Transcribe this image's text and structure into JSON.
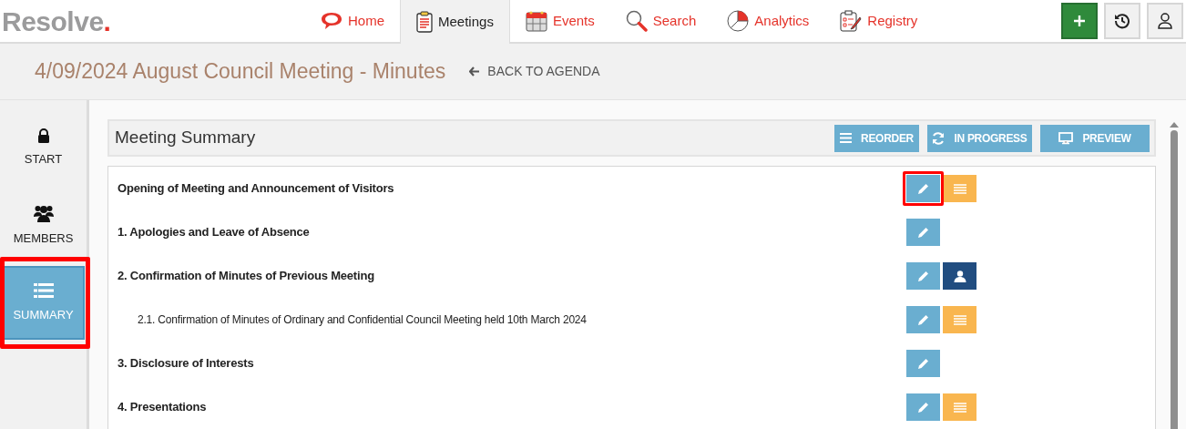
{
  "app": {
    "logo": "Resolve",
    "logo_dot": "."
  },
  "nav": [
    {
      "label": "Home",
      "kind": "home",
      "selected": false
    },
    {
      "label": "Meetings",
      "kind": "meetings",
      "selected": true
    },
    {
      "label": "Events",
      "kind": "events",
      "selected": false
    },
    {
      "label": "Search",
      "kind": "search",
      "selected": false
    },
    {
      "label": "Analytics",
      "kind": "analytics",
      "selected": false
    },
    {
      "label": "Registry",
      "kind": "registry",
      "selected": false
    }
  ],
  "actions": [
    {
      "kind": "add"
    },
    {
      "kind": "history"
    },
    {
      "kind": "user"
    }
  ],
  "page": {
    "title": "4/09/2024 August Council Meeting - Minutes",
    "back": "BACK TO AGENDA"
  },
  "sidebar": {
    "items": [
      {
        "label": "START",
        "kind": "lock",
        "selected": false,
        "highlighted": false
      },
      {
        "label": "MEMBERS",
        "kind": "members",
        "selected": false,
        "highlighted": false
      },
      {
        "label": "SUMMARY",
        "kind": "list",
        "selected": true,
        "highlighted": true
      }
    ]
  },
  "panel": {
    "title": "Meeting Summary",
    "buttons": [
      {
        "label": "REORDER",
        "kind": "reorder"
      },
      {
        "label": "IN PROGRESS",
        "kind": "progress"
      },
      {
        "label": "PREVIEW",
        "kind": "preview"
      }
    ],
    "items": [
      {
        "title": "Opening of Meeting and Announcement of Visitors",
        "edit_highlighted": true,
        "kind": "notes"
      },
      {
        "title": "1. Apologies and Leave of Absence",
        "edit_highlighted": false,
        "kind": "plain"
      },
      {
        "title": "2. Confirmation of Minutes of Previous Meeting",
        "edit_highlighted": false,
        "kind": "person",
        "children": [
          {
            "title": "2.1. Confirmation of Minutes of Ordinary and Confidential Council Meeting held 10th March 2024",
            "edit_highlighted": false,
            "kind": "notes"
          }
        ]
      },
      {
        "title": "3. Disclosure of Interests",
        "edit_highlighted": false,
        "kind": "plain"
      },
      {
        "title": "4. Presentations",
        "edit_highlighted": false,
        "kind": "notes"
      }
    ]
  }
}
